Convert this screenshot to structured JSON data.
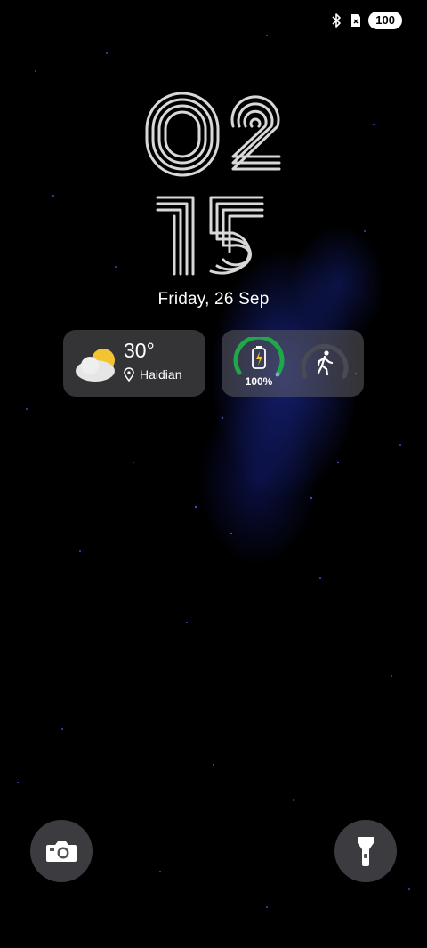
{
  "status": {
    "bluetooth_icon": "bluetooth-icon",
    "signal_icon": "no-sim-icon",
    "battery_level": "100"
  },
  "lockscreen": {
    "hour": "02",
    "minute": "15",
    "date": "Friday, 26 Sep"
  },
  "weather_widget": {
    "icon": "partly-cloudy-icon",
    "temperature": "30°",
    "location": "Haidian"
  },
  "battery_widget": {
    "percent_value": 100,
    "percent_label": "100%",
    "ring_color": "#1fa84a",
    "activity_icon": "walking-icon"
  },
  "shortcuts": {
    "left": "camera-icon",
    "right": "flashlight-icon"
  }
}
